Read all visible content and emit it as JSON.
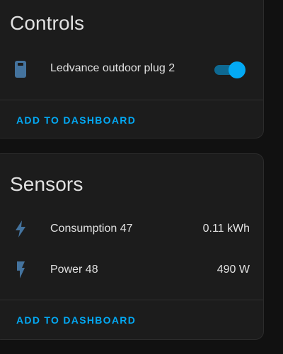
{
  "controls": {
    "title": "Controls",
    "entity": {
      "icon": "smart-plug-icon",
      "label": "Ledvance outdoor plug 2",
      "state": "on"
    },
    "add_button": "ADD TO DASHBOARD"
  },
  "sensors": {
    "title": "Sensors",
    "items": [
      {
        "icon": "lightning-bolt-icon",
        "label": "Consumption 47",
        "value": "0.11 kWh"
      },
      {
        "icon": "flash-icon",
        "label": "Power 48",
        "value": "490 W"
      }
    ],
    "add_button": "ADD TO DASHBOARD"
  },
  "colors": {
    "background": "#111111",
    "card": "#1c1c1c",
    "accent": "#03a9f4",
    "icon": "#44739e",
    "text": "#e1e1e1"
  }
}
